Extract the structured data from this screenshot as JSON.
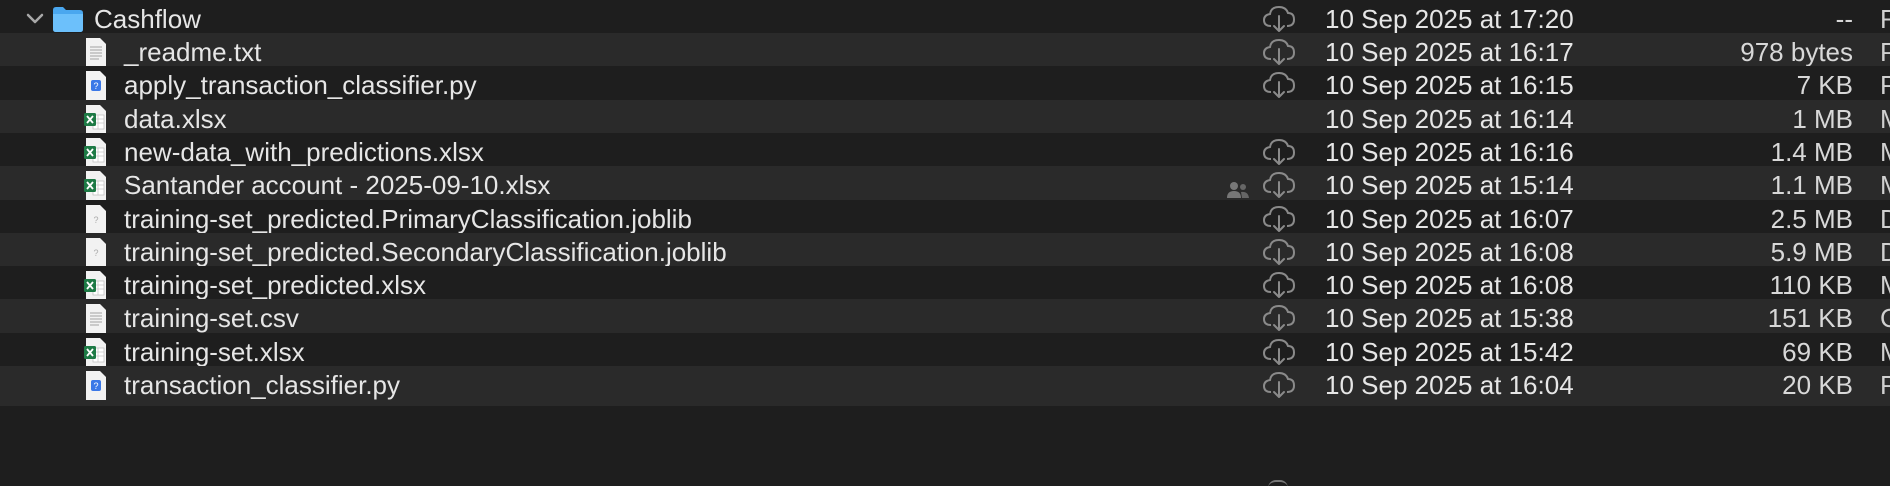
{
  "folder": {
    "name": "Cashflow",
    "date": "10 Sep 2025 at 17:20",
    "size": "--",
    "kind": "F",
    "expanded": true
  },
  "files": [
    {
      "name": "_readme.txt",
      "date": "10 Sep 2025 at 16:17",
      "size": "978 bytes",
      "kind": "P",
      "icon": "text-file-icon",
      "cloud": true,
      "shared": false
    },
    {
      "name": "apply_transaction_classifier.py",
      "date": "10 Sep 2025 at 16:15",
      "size": "7 KB",
      "kind": "P",
      "icon": "python-file-icon",
      "cloud": true,
      "shared": false
    },
    {
      "name": "data.xlsx",
      "date": "10 Sep 2025 at 16:14",
      "size": "1 MB",
      "kind": "M",
      "icon": "excel-file-icon",
      "cloud": false,
      "shared": false
    },
    {
      "name": "new-data_with_predictions.xlsx",
      "date": "10 Sep 2025 at 16:16",
      "size": "1.4 MB",
      "kind": "M",
      "icon": "excel-file-icon",
      "cloud": true,
      "shared": false
    },
    {
      "name": "Santander account - 2025-09-10.xlsx",
      "date": "10 Sep 2025 at 15:14",
      "size": "1.1 MB",
      "kind": "M",
      "icon": "excel-file-icon",
      "cloud": true,
      "shared": true
    },
    {
      "name": "training-set_predicted.PrimaryClassification.joblib",
      "date": "10 Sep 2025 at 16:07",
      "size": "2.5 MB",
      "kind": "D",
      "icon": "unknown-file-icon",
      "cloud": true,
      "shared": false
    },
    {
      "name": "training-set_predicted.SecondaryClassification.joblib",
      "date": "10 Sep 2025 at 16:08",
      "size": "5.9 MB",
      "kind": "D",
      "icon": "unknown-file-icon",
      "cloud": true,
      "shared": false
    },
    {
      "name": "training-set_predicted.xlsx",
      "date": "10 Sep 2025 at 16:08",
      "size": "110 KB",
      "kind": "M",
      "icon": "excel-file-icon",
      "cloud": true,
      "shared": false
    },
    {
      "name": "training-set.csv",
      "date": "10 Sep 2025 at 15:38",
      "size": "151 KB",
      "kind": "C",
      "icon": "csv-file-icon",
      "cloud": true,
      "shared": false
    },
    {
      "name": "training-set.xlsx",
      "date": "10 Sep 2025 at 15:42",
      "size": "69 KB",
      "kind": "M",
      "icon": "excel-file-icon",
      "cloud": true,
      "shared": false
    },
    {
      "name": "transaction_classifier.py",
      "date": "10 Sep 2025 at 16:04",
      "size": "20 KB",
      "kind": "P",
      "icon": "python-file-icon",
      "cloud": true,
      "shared": false
    }
  ],
  "colors": {
    "background": "#1e1e1e",
    "alt_row": "#2a2a2a",
    "text": "#e6e6e6",
    "folder_blue": "#5fb3f5",
    "excel_green": "#1d7a45",
    "python_blue": "#3b78e7"
  }
}
